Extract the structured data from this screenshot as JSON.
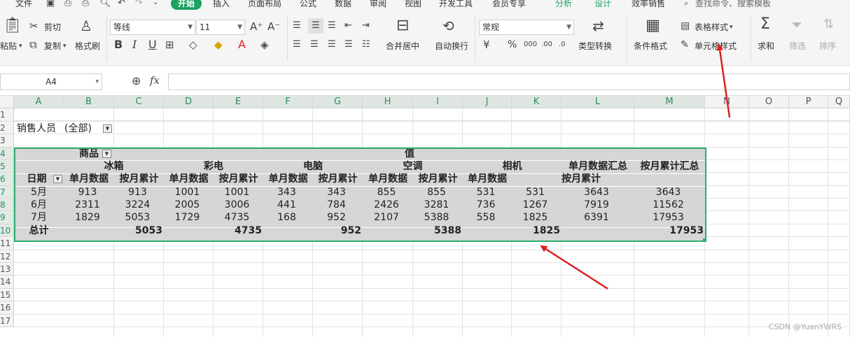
{
  "menu": [
    "文件",
    "开始",
    "插入",
    "页面布局",
    "公式",
    "数据",
    "审阅",
    "视图",
    "开发工具",
    "会员专享",
    "分析",
    "设计",
    "效率销售"
  ],
  "menu_active": "开始",
  "search_placeholder": "查找命令、搜索模板",
  "ribbon": {
    "paste": "粘贴",
    "cut": "剪切",
    "copy": "复制",
    "format_painter": "格式刷",
    "font_name": "等线",
    "font_size": "11",
    "merge_center": "合并居中",
    "wrap_text": "自动换行",
    "number_format": "常规",
    "type_convert": "类型转换",
    "conditional_format": "条件格式",
    "table_style": "表格样式",
    "cell_style": "单元格样式",
    "sum": "求和",
    "filter": "筛选",
    "sort": "排序"
  },
  "formula": {
    "namebox": "A4",
    "fx": "fx",
    "value": ""
  },
  "columns": [
    "A",
    "B",
    "C",
    "D",
    "E",
    "F",
    "G",
    "H",
    "I",
    "J",
    "K",
    "L",
    "M",
    "N",
    "O",
    "P",
    "Q"
  ],
  "rows": [
    "1",
    "2",
    "3",
    "4",
    "5",
    "6",
    "7",
    "8",
    "9",
    "10",
    "11",
    "12",
    "13",
    "14",
    "15",
    "16",
    "17"
  ],
  "pivot": {
    "filter_label": "销售人员",
    "filter_value": "(全部)",
    "row_field": "商品",
    "values_label": "值",
    "products": [
      "冰箱",
      "彩电",
      "电脑",
      "空调",
      "相机"
    ],
    "sum_monthly": "单月数据汇总",
    "sum_cumulative": "按月累计汇总",
    "date_label": "日期",
    "sub_headers": [
      "单月数据",
      "按月累计",
      "单月数据",
      "按月累计",
      "单月数据",
      "按月累计",
      "单月数据",
      "按月累计",
      "单月数据",
      "按月累计"
    ],
    "row_headers": [
      "5月",
      "6月",
      "7月"
    ],
    "rows": [
      [
        "913",
        "913",
        "1001",
        "1001",
        "343",
        "343",
        "855",
        "855",
        "531",
        "531",
        "3643",
        "3643"
      ],
      [
        "2311",
        "3224",
        "2005",
        "3006",
        "441",
        "784",
        "2426",
        "3281",
        "736",
        "1267",
        "7919",
        "11562"
      ],
      [
        "1829",
        "5053",
        "1729",
        "4735",
        "168",
        "952",
        "2107",
        "5388",
        "558",
        "1825",
        "6391",
        "17953"
      ]
    ],
    "total_label": "总计",
    "totals": [
      "5053",
      "4735",
      "952",
      "5388",
      "1825",
      "17953"
    ]
  },
  "watermark": "CSDN @YuanYWRS",
  "accent": "#1aa260",
  "arrow_color": "#e02020"
}
